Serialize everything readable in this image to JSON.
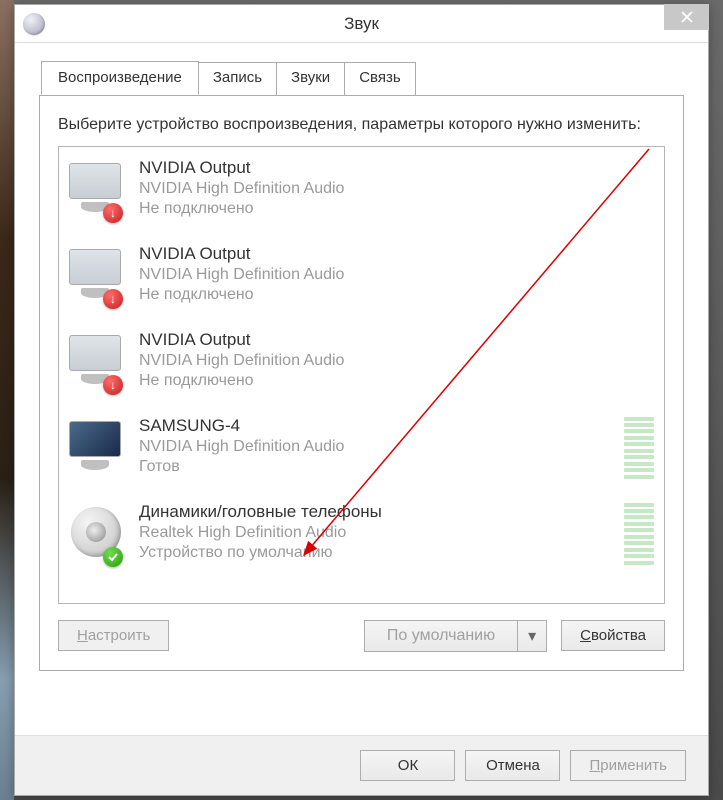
{
  "window": {
    "title": "Звук",
    "close_label": "Close"
  },
  "tabs": [
    {
      "label": "Воспроизведение",
      "active": true
    },
    {
      "label": "Запись",
      "active": false
    },
    {
      "label": "Звуки",
      "active": false
    },
    {
      "label": "Связь",
      "active": false
    }
  ],
  "instruction": "Выберите устройство воспроизведения, параметры которого нужно изменить:",
  "devices": [
    {
      "name": "NVIDIA Output",
      "desc": "NVIDIA High Definition Audio",
      "status": "Не подключено",
      "icon": "monitor-off",
      "badge": "down",
      "meter": false
    },
    {
      "name": "NVIDIA Output",
      "desc": "NVIDIA High Definition Audio",
      "status": "Не подключено",
      "icon": "monitor-off",
      "badge": "down",
      "meter": false
    },
    {
      "name": "NVIDIA Output",
      "desc": "NVIDIA High Definition Audio",
      "status": "Не подключено",
      "icon": "monitor-off",
      "badge": "down",
      "meter": false
    },
    {
      "name": "SAMSUNG-4",
      "desc": "NVIDIA High Definition Audio",
      "status": "Готов",
      "icon": "monitor-on",
      "badge": "none",
      "meter": true
    },
    {
      "name": "Динамики/головные телефоны",
      "desc": "Realtek High Definition Audio",
      "status": "Устройство по умолчанию",
      "icon": "speaker",
      "badge": "check",
      "meter": true
    }
  ],
  "panel_buttons": {
    "configure": "Настроить",
    "default": "По умолчанию",
    "properties": "Свойства"
  },
  "dialog_buttons": {
    "ok": "ОК",
    "cancel": "Отмена",
    "apply": "Применить"
  }
}
